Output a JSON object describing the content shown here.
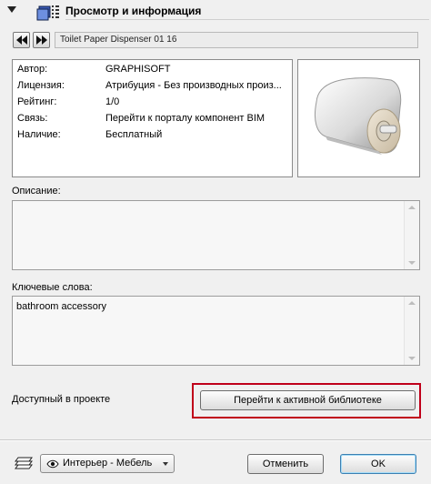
{
  "header": {
    "title": "Просмотр и информация",
    "icon": "object-info-icon"
  },
  "nav": {
    "prev_icon": "previous-icon",
    "next_icon": "next-icon",
    "object_name": "Toilet Paper Dispenser 01 16"
  },
  "info": {
    "rows": [
      {
        "key": "Автор:",
        "value": "GRAPHISOFT"
      },
      {
        "key": "Лицензия:",
        "value": "Атрибуция - Без производных произ..."
      },
      {
        "key": "Рейтинг:",
        "value": "1/0"
      },
      {
        "key": "Связь:",
        "value": "Перейти к порталу компонент BIM"
      },
      {
        "key": "Наличие:",
        "value": "Бесплатный"
      }
    ]
  },
  "description": {
    "label": "Описание:",
    "value": ""
  },
  "keywords": {
    "label": "Ключевые слова:",
    "value": "bathroom accessory"
  },
  "availability": {
    "label": "Доступный в проекте",
    "button_label": "Перейти к активной библиотеке"
  },
  "footer": {
    "layer_label": "Интерьер - Мебель",
    "cancel_label": "Отменить",
    "ok_label": "OK"
  },
  "colors": {
    "highlight": "#c0001a",
    "background": "#f0f0f0"
  }
}
